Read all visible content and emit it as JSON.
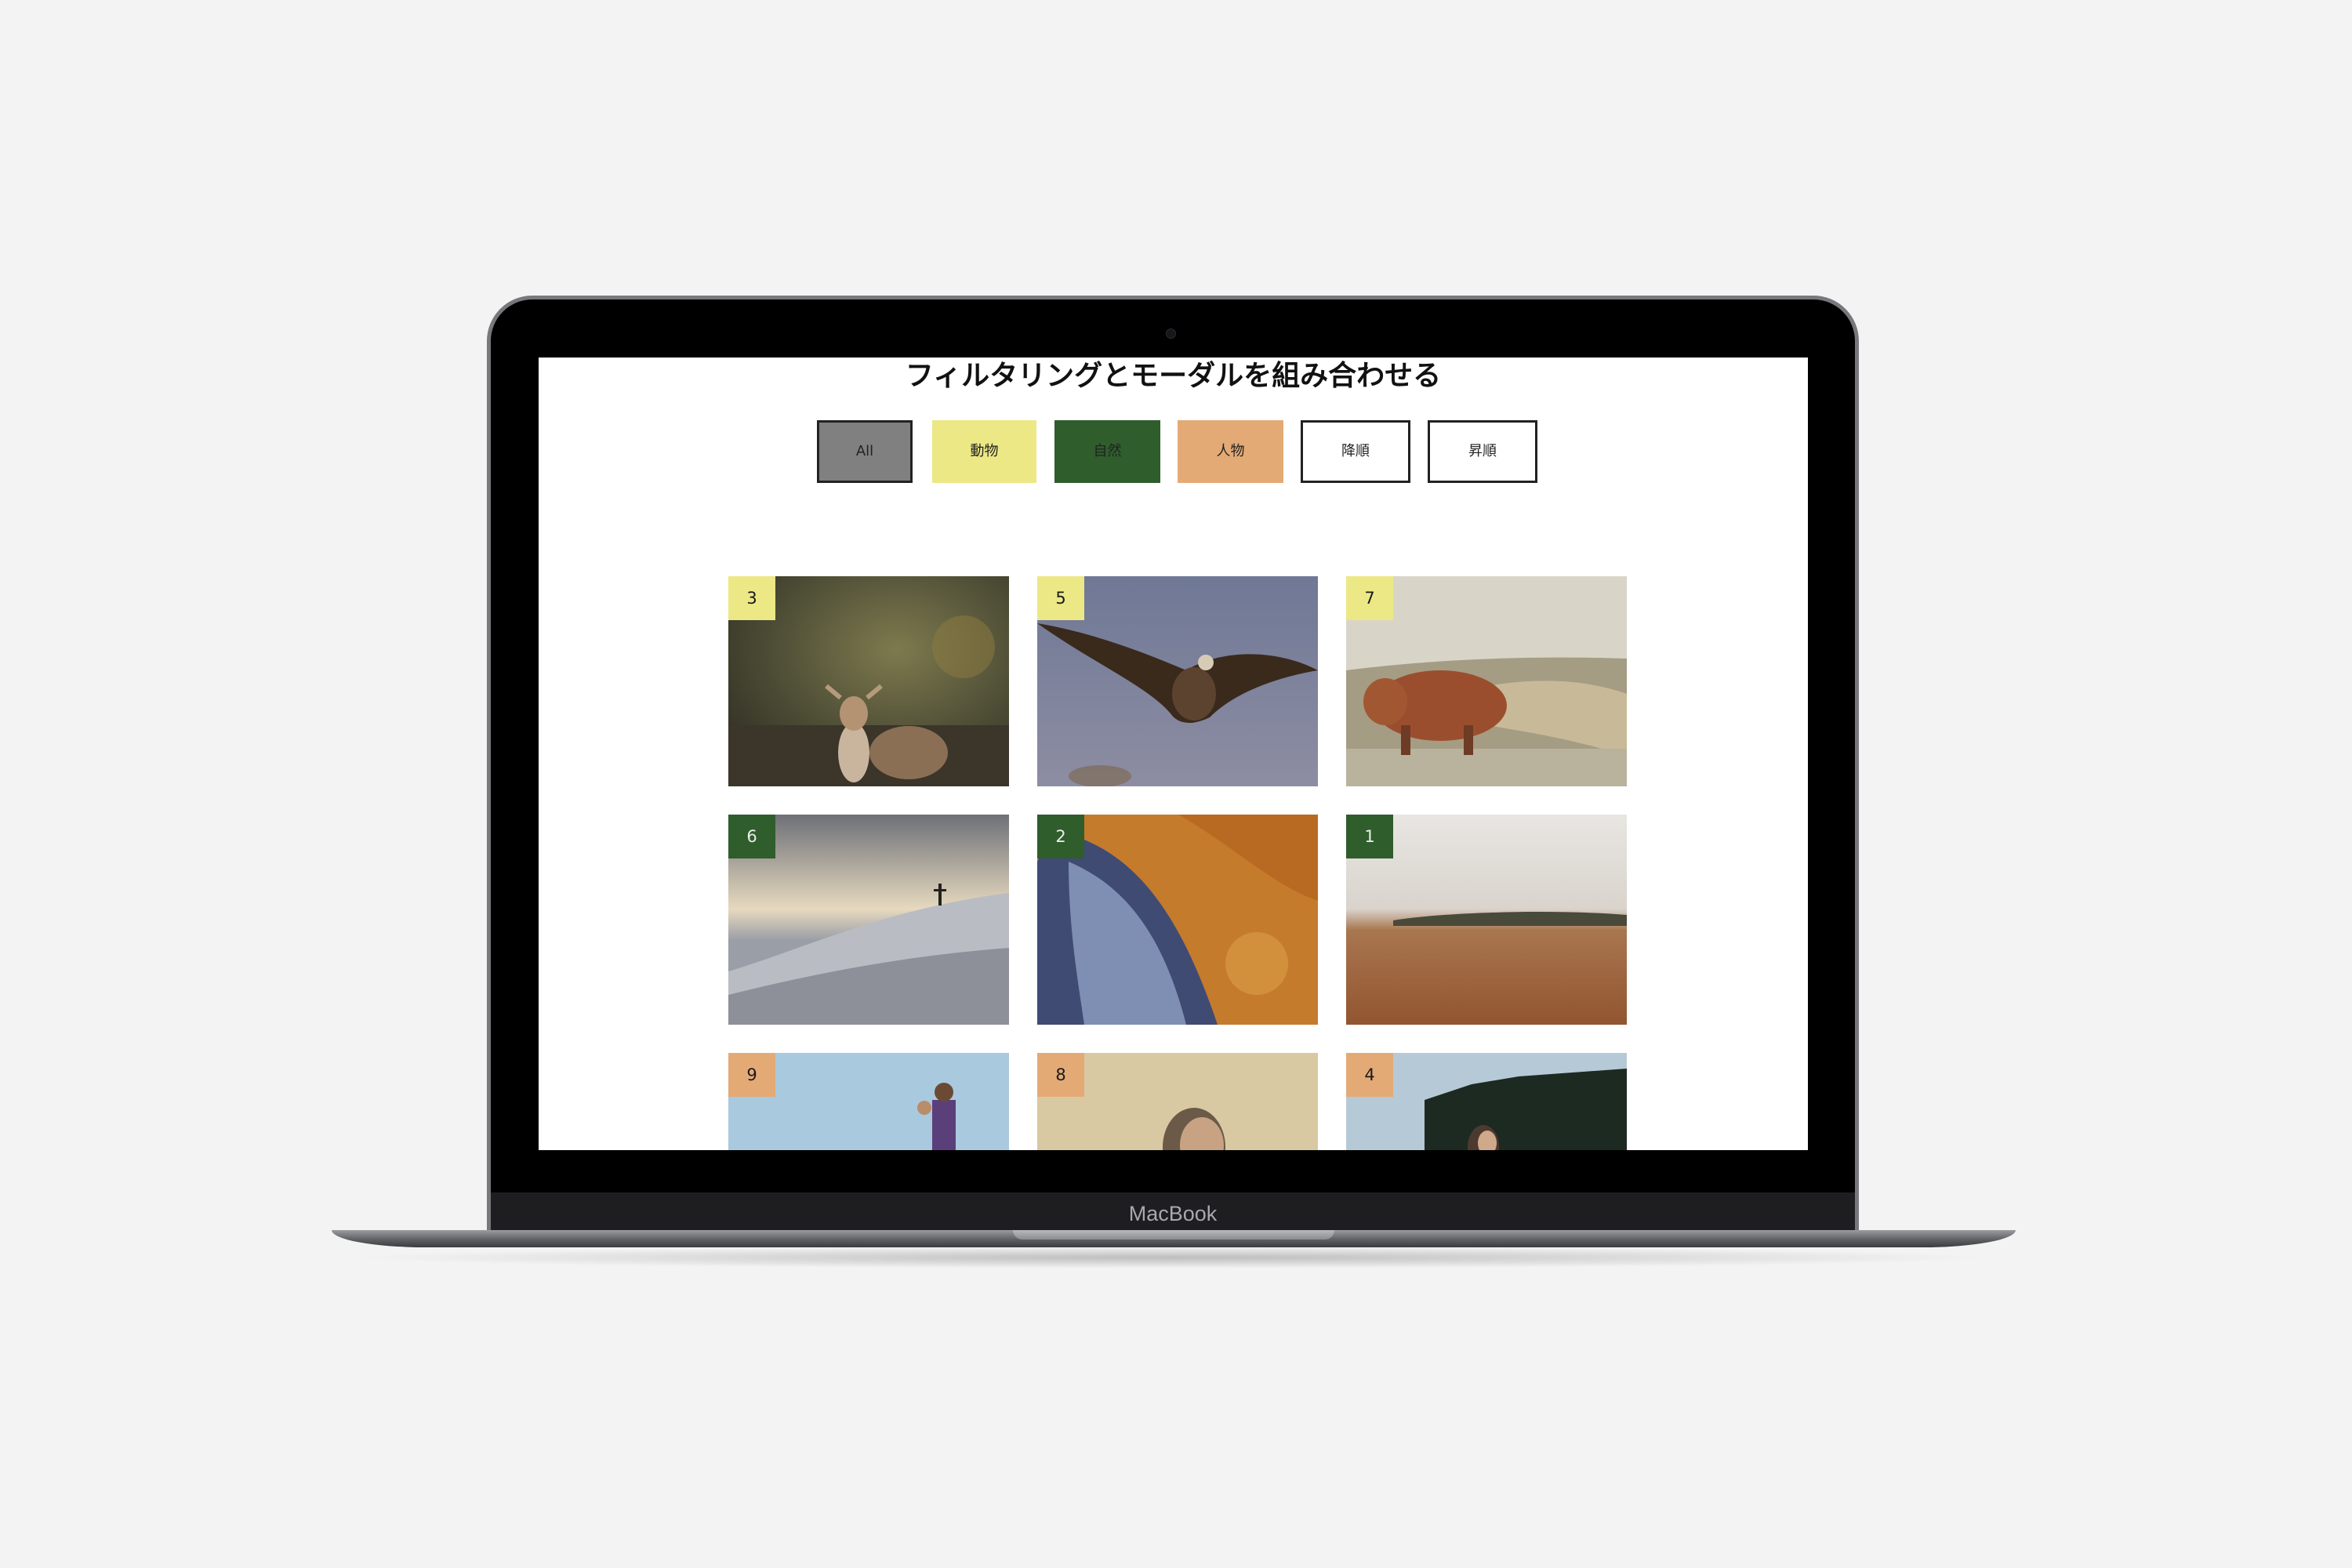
{
  "device": {
    "brand_label": "MacBook"
  },
  "page": {
    "title": "フィルタリングとモーダルを組み合わせる"
  },
  "filters": [
    {
      "label": "All"
    },
    {
      "label": "動物"
    },
    {
      "label": "自然"
    },
    {
      "label": "人物"
    },
    {
      "label": "降順"
    },
    {
      "label": "昇順"
    }
  ],
  "colors": {
    "animal": "#ece885",
    "nature": "#2f5d2c",
    "person": "#e4aa76",
    "all": "#808080"
  },
  "gallery": [
    {
      "number": "3",
      "category": "animal",
      "subject": "deer"
    },
    {
      "number": "5",
      "category": "animal",
      "subject": "eagle"
    },
    {
      "number": "7",
      "category": "animal",
      "subject": "highland-cow"
    },
    {
      "number": "6",
      "category": "nature",
      "subject": "snowy-summit"
    },
    {
      "number": "2",
      "category": "nature",
      "subject": "aerial-canyon"
    },
    {
      "number": "1",
      "category": "nature",
      "subject": "beach"
    },
    {
      "number": "9",
      "category": "person",
      "subject": "father-child"
    },
    {
      "number": "8",
      "category": "person",
      "subject": "woman-portrait"
    },
    {
      "number": "4",
      "category": "person",
      "subject": "woman-forest"
    }
  ]
}
